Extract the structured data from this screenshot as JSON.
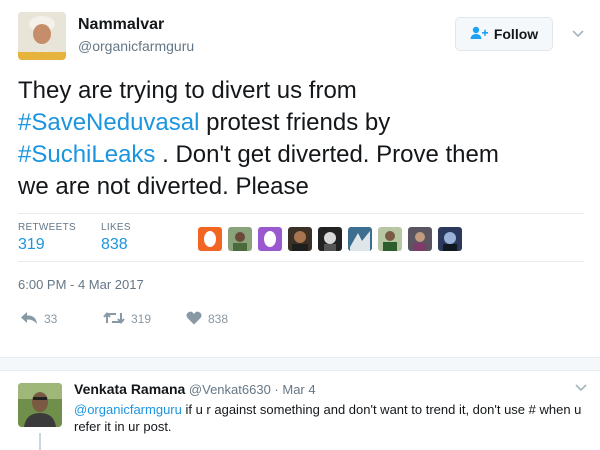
{
  "author": {
    "display_name": "Nammalvar",
    "handle": "@organicfarmguru"
  },
  "follow_button": {
    "label": "Follow"
  },
  "tweet": {
    "line1": "They are trying to divert us from",
    "hashtag1": "#SaveNeduvasal",
    "line2_rest": " protest friends by",
    "hashtag2": "#SuchiLeaks",
    "line3_rest": " . Don't get diverted. Prove them",
    "line4": "we are not diverted. Please"
  },
  "stats": {
    "retweets_label": "RETWEETS",
    "retweets_value": "319",
    "likes_label": "LIKES",
    "likes_value": "838"
  },
  "timestamp": "6:00 PM - 4 Mar 2017",
  "actions": {
    "reply_count": "33",
    "retweet_count": "319",
    "like_count": "838"
  },
  "reply": {
    "name": "Venkata Ramana",
    "handle": "@Venkat6630",
    "separator": " · ",
    "date": "Mar 4",
    "mention": "@organicfarmguru",
    "text_after_mention": " if u r against something and don't want to trend it, don't use # when u refer it in ur post."
  },
  "colors": {
    "link": "#1b95e0",
    "text": "#14171a",
    "muted": "#657786",
    "action_icon": "#8899a6"
  },
  "icons": {
    "follow": "add-user-icon",
    "caret": "chevron-down-icon",
    "reply": "reply-icon",
    "retweet": "retweet-icon",
    "like": "heart-icon"
  }
}
